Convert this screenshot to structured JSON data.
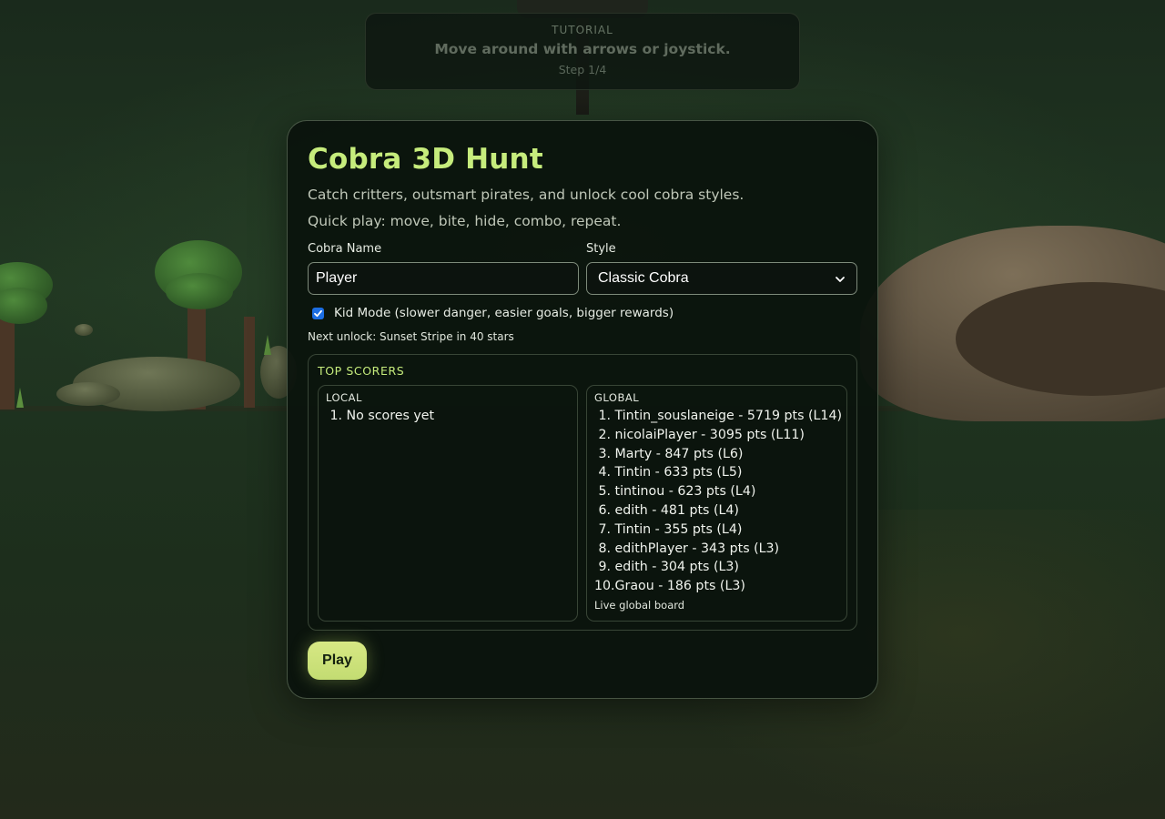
{
  "tutorial": {
    "label": "TUTORIAL",
    "message": "Move around with arrows or joystick.",
    "step": "Step 1/4"
  },
  "menu": {
    "title": "Cobra 3D Hunt",
    "subtitle": "Catch critters, outsmart pirates, and unlock cool cobra styles.",
    "quickplay": "Quick play: move, bite, hide, combo, repeat.",
    "name_label": "Cobra Name",
    "name_value": "Player",
    "style_label": "Style",
    "style_value": "Classic Cobra",
    "kid_mode_label": "Kid Mode (slower danger, easier goals, bigger rewards)",
    "kid_mode_checked": true,
    "next_unlock": "Next unlock: Sunset Stripe in 40 stars",
    "play_label": "Play"
  },
  "scores": {
    "title": "TOP SCORERS",
    "local": {
      "title": "LOCAL",
      "entries": [
        {
          "rank": "1.",
          "text": "No scores yet"
        }
      ]
    },
    "global": {
      "title": "GLOBAL",
      "entries": [
        {
          "rank": "1.",
          "text": "Tintin_souslaneige - 5719 pts (L14)"
        },
        {
          "rank": "2.",
          "text": "nicolaiPlayer - 3095 pts (L11)"
        },
        {
          "rank": "3.",
          "text": "Marty - 847 pts (L6)"
        },
        {
          "rank": "4.",
          "text": "Tintin - 633 pts (L5)"
        },
        {
          "rank": "5.",
          "text": "tintinou - 623 pts (L4)"
        },
        {
          "rank": "6.",
          "text": "edith - 481 pts (L4)"
        },
        {
          "rank": "7.",
          "text": "Tintin - 355 pts (L4)"
        },
        {
          "rank": "8.",
          "text": "edithPlayer - 343 pts (L3)"
        },
        {
          "rank": "9.",
          "text": "edith - 304 pts (L3)"
        },
        {
          "rank": "10.",
          "text": "Graou - 186 pts (L3)"
        }
      ],
      "note": "Live global board"
    }
  },
  "colors": {
    "accent": "#c6ec7c",
    "play_button": "#d4e67f",
    "checkbox": "#1c6ee3"
  }
}
